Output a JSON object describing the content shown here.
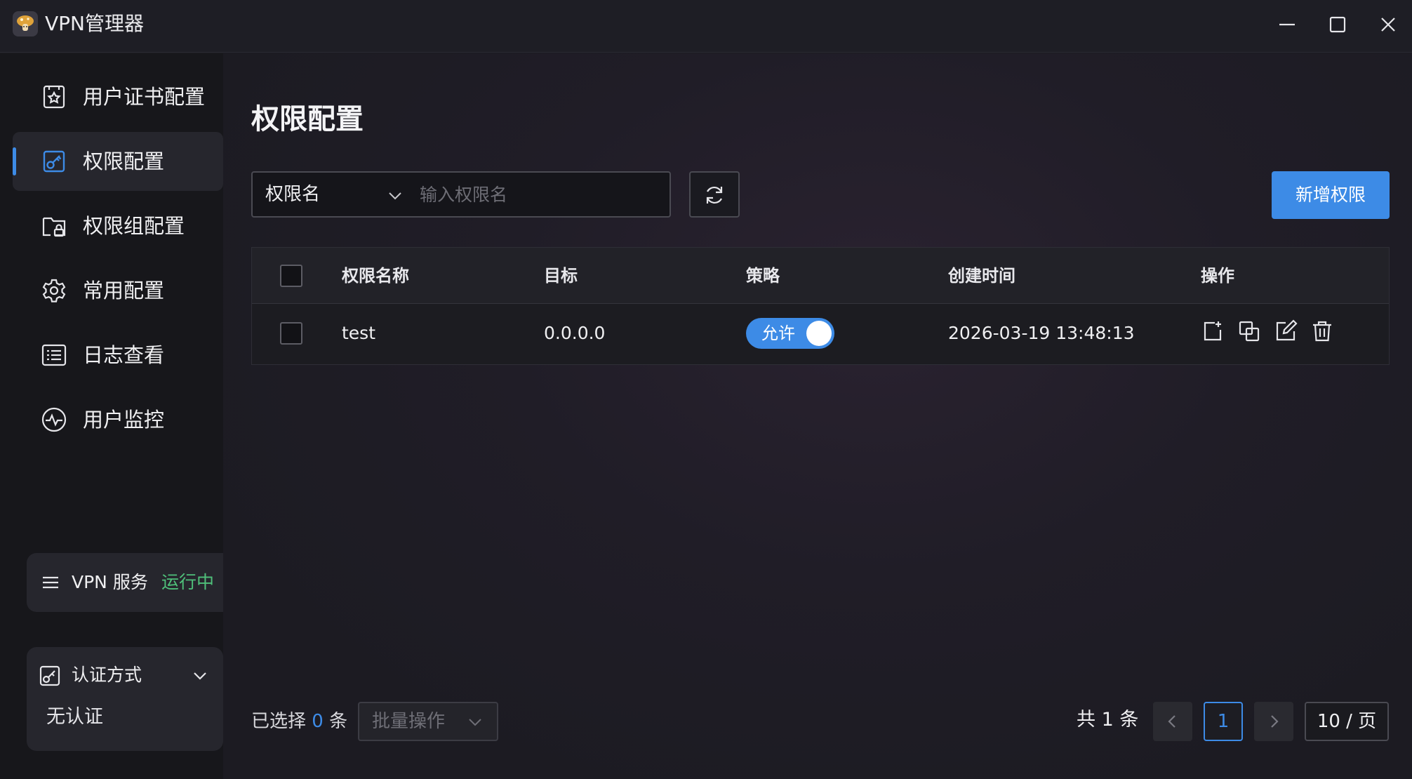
{
  "app": {
    "title": "VPN管理器",
    "logo_icon": "mushroom-logo-icon",
    "window_controls": [
      "minimize-icon",
      "maximize-icon",
      "close-icon"
    ]
  },
  "sidebar": {
    "items": [
      {
        "label": "用户证书配置",
        "icon": "certificate-icon",
        "active": false
      },
      {
        "label": "权限配置",
        "icon": "key-icon",
        "active": true
      },
      {
        "label": "权限组配置",
        "icon": "folder-lock-icon",
        "active": false
      },
      {
        "label": "常用配置",
        "icon": "gear-icon",
        "active": false
      },
      {
        "label": "日志查看",
        "icon": "list-icon",
        "active": false
      },
      {
        "label": "用户监控",
        "icon": "pulse-icon",
        "active": false
      }
    ],
    "vpn_service": {
      "label": "VPN 服务",
      "status": "运行中",
      "status_color": "#4fc07a"
    },
    "auth": {
      "label": "认证方式",
      "value": "无认证"
    }
  },
  "main": {
    "title": "权限配置",
    "search": {
      "field": "权限名",
      "placeholder": "输入权限名",
      "value": ""
    },
    "add_button": "新增权限",
    "table": {
      "columns": [
        "权限名称",
        "目标",
        "策略",
        "创建时间",
        "操作"
      ],
      "rows": [
        {
          "name": "test",
          "target": "0.0.0.0",
          "policy": "允许",
          "policy_on": true,
          "created": "2026-03-19 13:48:13",
          "actions": [
            "add-icon",
            "copy-icon",
            "edit-icon",
            "delete-icon"
          ]
        }
      ]
    },
    "footer": {
      "selected_prefix": "已选择",
      "selected_count": "0",
      "selected_suffix": "条",
      "bulk_action": "批量操作",
      "total": "共 1 条",
      "current_page": "1",
      "page_size": "10 / 页"
    }
  },
  "colors": {
    "accent": "#3d8be6",
    "running": "#4fc07a"
  }
}
